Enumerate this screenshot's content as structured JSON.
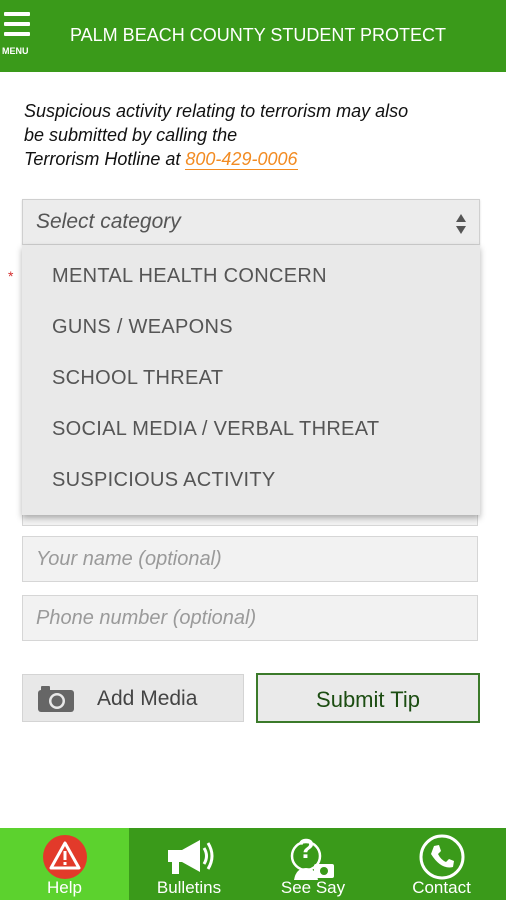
{
  "header": {
    "menu_label": "MENU",
    "title": "PALM BEACH COUNTY STUDENT PROTECT",
    "bg_color": "#3a9a1a"
  },
  "info": {
    "line1": "Suspicious activity relating to terrorism may also",
    "line2": "be submitted by calling the",
    "hotline_label": "Terrorism Hotline",
    "at": " at ",
    "phone": "800-429-0006",
    "phone_color": "#f28b22"
  },
  "category_select": {
    "placeholder": "Select category",
    "required_mark": "*",
    "options": [
      "MENTAL HEALTH CONCERN",
      "GUNS / WEAPONS",
      "SCHOOL THREAT",
      "SOCIAL MEDIA / VERBAL THREAT",
      "SUSPICIOUS ACTIVITY"
    ]
  },
  "form": {
    "name_placeholder": "Your name (optional)",
    "phone_placeholder": "Phone number (optional)"
  },
  "buttons": {
    "add_media": "Add Media",
    "submit": "Submit Tip"
  },
  "tabbar": {
    "tabs": [
      {
        "label": "Help",
        "icon": "warning-icon",
        "active": true
      },
      {
        "label": "Bulletins",
        "icon": "megaphone-icon",
        "active": false
      },
      {
        "label": "See Say",
        "icon": "question-camera-icon",
        "active": false
      },
      {
        "label": "Contact",
        "icon": "phone-icon",
        "active": false
      }
    ],
    "active_color": "#5cd22e"
  }
}
